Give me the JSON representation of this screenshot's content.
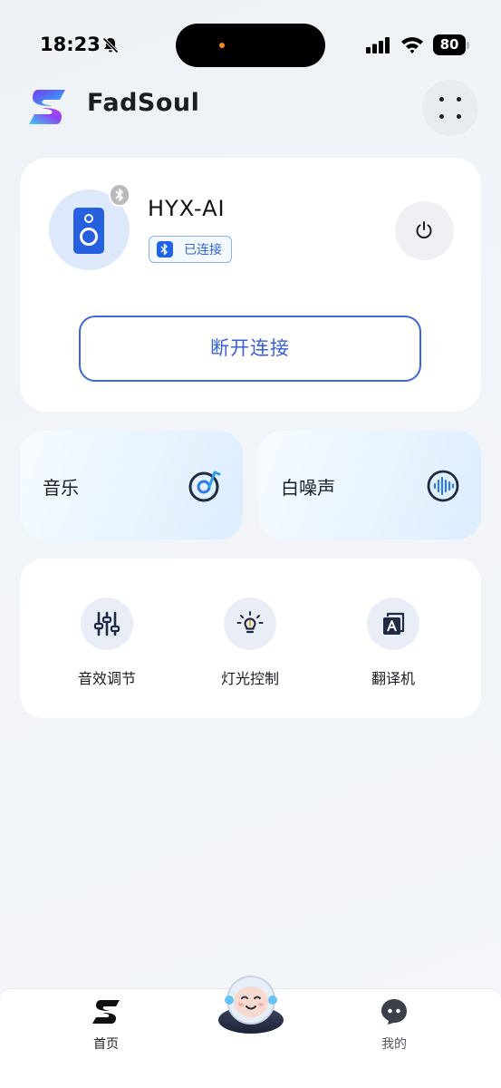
{
  "status_bar": {
    "time": "18:23",
    "battery": "80"
  },
  "header": {
    "app_name": "FadSoul"
  },
  "device": {
    "name": "HYX-AI",
    "status": "已连接",
    "disconnect_label": "断开连接"
  },
  "features": [
    {
      "label": "音乐",
      "icon": "music-disc-icon"
    },
    {
      "label": "白噪声",
      "icon": "sound-wave-icon"
    }
  ],
  "tools": [
    {
      "label": "音效调节",
      "icon": "equalizer-icon"
    },
    {
      "label": "灯光控制",
      "icon": "light-bulb-icon"
    },
    {
      "label": "翻译机",
      "icon": "translate-icon"
    }
  ],
  "nav": {
    "home_label": "首页",
    "mine_label": "我的"
  },
  "colors": {
    "accent": "#3a62d6",
    "speaker": "#2760df",
    "tile_bg": "#e7f3ff",
    "icon_dark": "#1f2a44"
  }
}
